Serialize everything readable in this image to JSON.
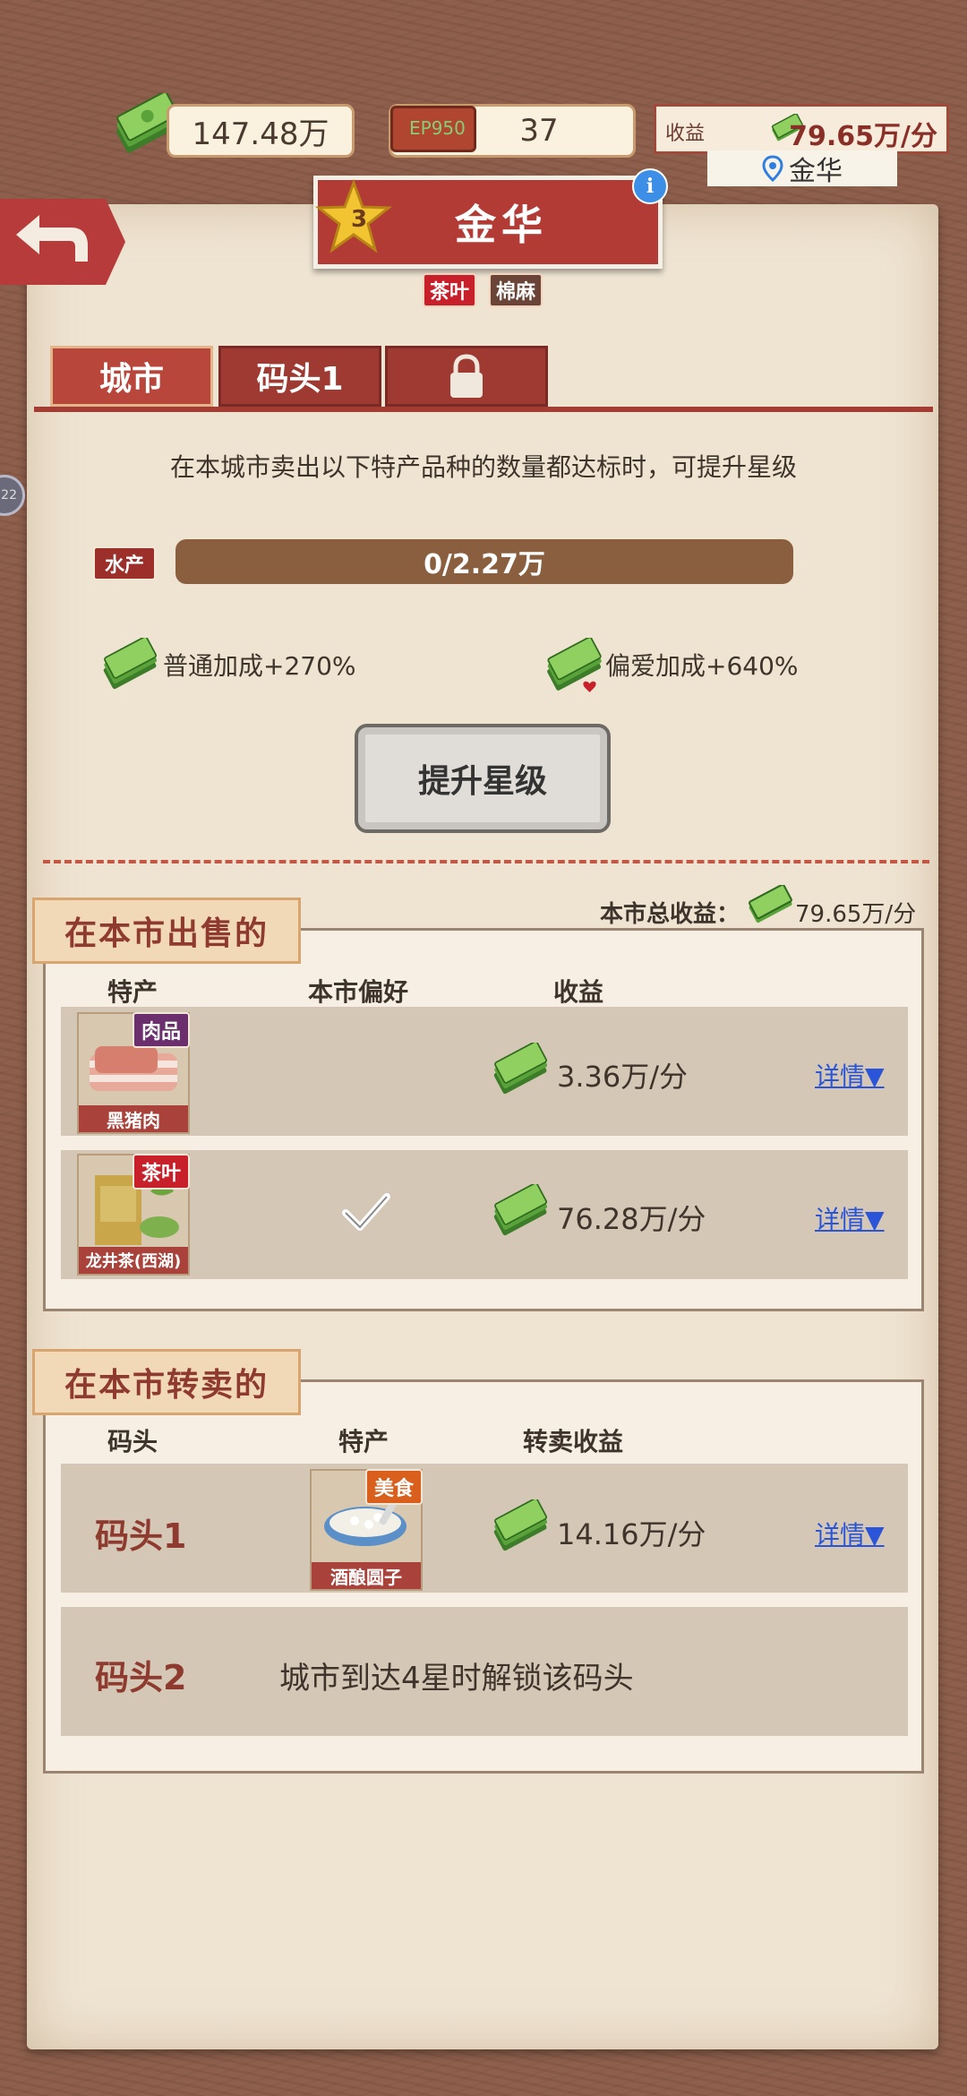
{
  "topbar": {
    "cash": "147.48万",
    "tickets": "37",
    "ticket_badge": "EP950",
    "income_label": "收益",
    "income_value": "79.65万/分",
    "location": "金华"
  },
  "city": {
    "star_level": "3",
    "name": "金华",
    "tags": [
      "茶叶",
      "棉麻"
    ]
  },
  "tabs": [
    "城市",
    "码头1"
  ],
  "requirement": {
    "description": "在本城市卖出以下特产品种的数量都达标时，可提升星级",
    "category": "水产",
    "progress_text": "0/2.27万",
    "progress_fraction": 0.0
  },
  "bonuses": {
    "normal": "普通加成+270%",
    "favorite": "偏爱加成+640%"
  },
  "upgrade_button": "提升星级",
  "selling": {
    "title": "在本市出售的",
    "total_label": "本市总收益：",
    "total_value": "79.65万/分",
    "headers": [
      "特产",
      "本市偏好",
      "收益"
    ],
    "items": [
      {
        "tag": "肉品",
        "tag_color": "#6b2f6e",
        "name": "黑猪肉",
        "preferred": false,
        "income": "3.36万/分",
        "detail": "详情"
      },
      {
        "tag": "茶叶",
        "tag_color": "#c8202a",
        "name": "龙井茶(西湖)",
        "preferred": true,
        "income": "76.28万/分",
        "detail": "详情"
      }
    ]
  },
  "resale": {
    "title": "在本市转卖的",
    "headers": [
      "码头",
      "特产",
      "转卖收益"
    ],
    "items": [
      {
        "wharf": "码头1",
        "tag": "美食",
        "tag_color": "#d8601c",
        "product": "酒酿圆子",
        "income": "14.16万/分",
        "detail": "详情"
      },
      {
        "wharf": "码头2",
        "locked_text": "城市到达4星时解锁该码头"
      }
    ]
  },
  "side_badge": "22",
  "colors": {
    "accent_red": "#b23b36",
    "panel": "#efe4d2",
    "link": "#2a55d8"
  }
}
